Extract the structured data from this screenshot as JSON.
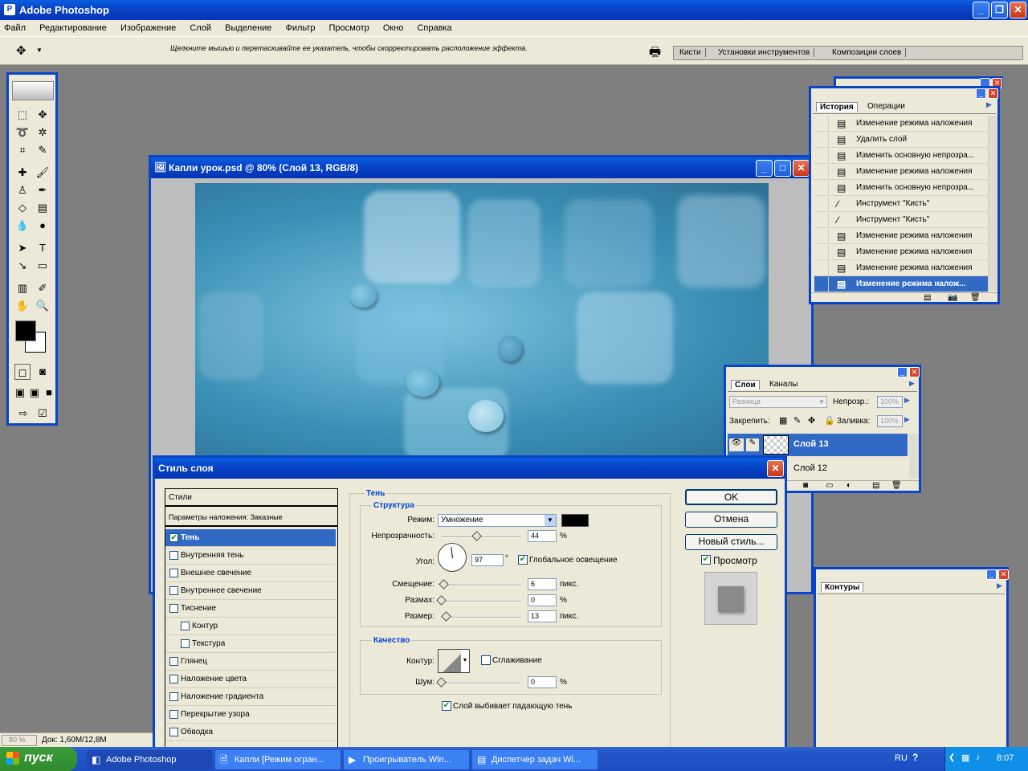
{
  "app": {
    "title": "Adobe Photoshop"
  },
  "menu": [
    "Файл",
    "Редактирование",
    "Изображение",
    "Слой",
    "Выделение",
    "Фильтр",
    "Просмотр",
    "Окно",
    "Справка"
  ],
  "options_bar": {
    "hint": "Щелкните мышью и перетаскивайте ее указатель, чтобы скорректировать расположение эффекта.",
    "tabs": [
      "Кисти",
      "Установки инструментов",
      "Композиции слоев"
    ]
  },
  "document": {
    "title": "Капли урок.psd @ 80% (Слой 13, RGB/8)"
  },
  "status": {
    "zoom": "80 %",
    "doc": "Док: 1,60M/12,8M"
  },
  "history": {
    "tabs": [
      "История",
      "Операции"
    ],
    "items": [
      {
        "label": "Изменение режима наложения",
        "icon": "history-doc-icon"
      },
      {
        "label": "Удалить слой",
        "icon": "history-doc-icon"
      },
      {
        "label": "Изменить основную непрозра...",
        "icon": "history-doc-icon"
      },
      {
        "label": "Изменение режима наложения",
        "icon": "history-doc-icon"
      },
      {
        "label": "Изменить основную непрозра...",
        "icon": "history-doc-icon"
      },
      {
        "label": "Инструмент \"Кисть\"",
        "icon": "brush-icon"
      },
      {
        "label": "Инструмент \"Кисть\"",
        "icon": "brush-icon"
      },
      {
        "label": "Изменение режима наложения",
        "icon": "history-doc-icon"
      },
      {
        "label": "Изменение режима наложения",
        "icon": "history-doc-icon"
      },
      {
        "label": "Изменение режима наложения",
        "icon": "history-doc-icon"
      },
      {
        "label": "Изменение режима налож...",
        "icon": "history-doc-icon"
      }
    ]
  },
  "layers": {
    "tabs": [
      "Слои",
      "Каналы"
    ],
    "blend_mode": "Разница",
    "opacity_label": "Непрозр.:",
    "opacity": "100%",
    "lock_label": "Закрепить:",
    "fill_label": "Заливка:",
    "fill": "100%",
    "items": [
      {
        "name": "Слой 13"
      },
      {
        "name": "Слой 12"
      }
    ]
  },
  "paths": {
    "tab": "Контуры"
  },
  "layer_style": {
    "title": "Стиль слоя",
    "styles_header": "Стили",
    "blend_options": "Параметры наложения: Заказные",
    "items": [
      {
        "label": "Тень",
        "checked": true
      },
      {
        "label": "Внутренняя тень",
        "checked": false
      },
      {
        "label": "Внешнее свечение",
        "checked": false
      },
      {
        "label": "Внутреннее свечение",
        "checked": false
      },
      {
        "label": "Тиснение",
        "checked": false
      },
      {
        "label": "Контур",
        "checked": false
      },
      {
        "label": "Текстура",
        "checked": false
      },
      {
        "label": "Глянец",
        "checked": false
      },
      {
        "label": "Наложение цвета",
        "checked": false
      },
      {
        "label": "Наложение градиента",
        "checked": false
      },
      {
        "label": "Перекрытие узора",
        "checked": false
      },
      {
        "label": "Обводка",
        "checked": false
      }
    ],
    "section": "Тень",
    "structure": "Структура",
    "mode_label": "Режим:",
    "mode": "Умножение",
    "shadow_color": "#000000",
    "opacity_label": "Непрозрачность:",
    "opacity": "44",
    "opacity_frac": 0.44,
    "angle_label": "Угол:",
    "angle": "97",
    "degree": "°",
    "global_light": "Глобальное освещение",
    "distance_label": "Смещение:",
    "distance": "6",
    "distance_frac": 0.03,
    "spread_label": "Размах:",
    "spread": "0",
    "spread_frac": 0.0,
    "size_label": "Размер:",
    "size": "13",
    "size_frac": 0.06,
    "px": "пикс.",
    "pct": "%",
    "quality": "Качество",
    "contour_label": "Контур:",
    "antialias": "Сглаживание",
    "noise_label": "Шум:",
    "noise": "0",
    "noise_frac": 0.0,
    "knockout": "Слой выбивает падающую тень",
    "ok": "OK",
    "cancel": "Отмена",
    "new_style": "Новый стиль...",
    "preview": "Просмотр"
  },
  "taskbar": {
    "start": "пуск",
    "items": [
      "Adobe Photoshop",
      "Капли [Режим огран...",
      "Проигрыватель Win...",
      "Диспетчер задач Wi..."
    ],
    "lang": "RU",
    "time": "8:07"
  }
}
